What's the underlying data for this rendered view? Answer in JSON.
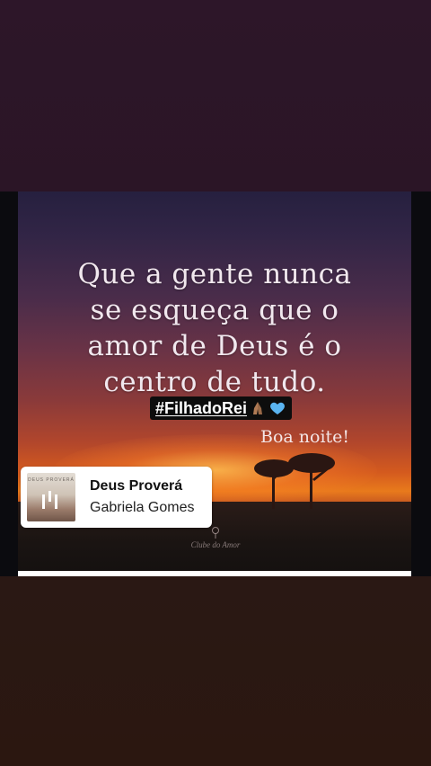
{
  "post": {
    "quote_lines": [
      "Que a gente nunca",
      "se esqueça que o",
      "amor de Deus é o",
      "centro de tudo."
    ],
    "greeting": "Boa noite!",
    "watermark": "Clube do Amor",
    "hashtag": "#FilhadoRei"
  },
  "music": {
    "title": "Deus Proverá",
    "artist": "Gabriela Gomes",
    "album_text": "DEUS PROVERÁ"
  },
  "story": {
    "progress": 1.0
  },
  "colors": {
    "background": "#2b1624",
    "progress_bar": "#ffffff",
    "hashtag_bg": "#0d0d0d",
    "heart": "#5ab4f0"
  },
  "icons": {
    "hashtag_emoji": [
      "praying-hands-icon",
      "blue-heart-icon"
    ],
    "album_art": "music-bars-icon",
    "watermark_logo": "rose-icon"
  }
}
